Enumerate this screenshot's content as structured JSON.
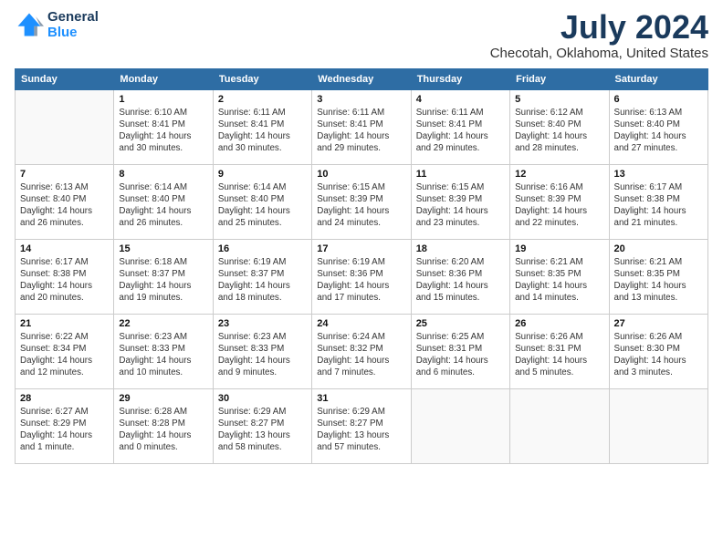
{
  "header": {
    "logo_line1": "General",
    "logo_line2": "Blue",
    "main_title": "July 2024",
    "sub_title": "Checotah, Oklahoma, United States"
  },
  "calendar": {
    "headers": [
      "Sunday",
      "Monday",
      "Tuesday",
      "Wednesday",
      "Thursday",
      "Friday",
      "Saturday"
    ],
    "rows": [
      [
        {
          "num": "",
          "info": ""
        },
        {
          "num": "1",
          "info": "Sunrise: 6:10 AM\nSunset: 8:41 PM\nDaylight: 14 hours\nand 30 minutes."
        },
        {
          "num": "2",
          "info": "Sunrise: 6:11 AM\nSunset: 8:41 PM\nDaylight: 14 hours\nand 30 minutes."
        },
        {
          "num": "3",
          "info": "Sunrise: 6:11 AM\nSunset: 8:41 PM\nDaylight: 14 hours\nand 29 minutes."
        },
        {
          "num": "4",
          "info": "Sunrise: 6:11 AM\nSunset: 8:41 PM\nDaylight: 14 hours\nand 29 minutes."
        },
        {
          "num": "5",
          "info": "Sunrise: 6:12 AM\nSunset: 8:40 PM\nDaylight: 14 hours\nand 28 minutes."
        },
        {
          "num": "6",
          "info": "Sunrise: 6:13 AM\nSunset: 8:40 PM\nDaylight: 14 hours\nand 27 minutes."
        }
      ],
      [
        {
          "num": "7",
          "info": "Sunrise: 6:13 AM\nSunset: 8:40 PM\nDaylight: 14 hours\nand 26 minutes."
        },
        {
          "num": "8",
          "info": "Sunrise: 6:14 AM\nSunset: 8:40 PM\nDaylight: 14 hours\nand 26 minutes."
        },
        {
          "num": "9",
          "info": "Sunrise: 6:14 AM\nSunset: 8:40 PM\nDaylight: 14 hours\nand 25 minutes."
        },
        {
          "num": "10",
          "info": "Sunrise: 6:15 AM\nSunset: 8:39 PM\nDaylight: 14 hours\nand 24 minutes."
        },
        {
          "num": "11",
          "info": "Sunrise: 6:15 AM\nSunset: 8:39 PM\nDaylight: 14 hours\nand 23 minutes."
        },
        {
          "num": "12",
          "info": "Sunrise: 6:16 AM\nSunset: 8:39 PM\nDaylight: 14 hours\nand 22 minutes."
        },
        {
          "num": "13",
          "info": "Sunrise: 6:17 AM\nSunset: 8:38 PM\nDaylight: 14 hours\nand 21 minutes."
        }
      ],
      [
        {
          "num": "14",
          "info": "Sunrise: 6:17 AM\nSunset: 8:38 PM\nDaylight: 14 hours\nand 20 minutes."
        },
        {
          "num": "15",
          "info": "Sunrise: 6:18 AM\nSunset: 8:37 PM\nDaylight: 14 hours\nand 19 minutes."
        },
        {
          "num": "16",
          "info": "Sunrise: 6:19 AM\nSunset: 8:37 PM\nDaylight: 14 hours\nand 18 minutes."
        },
        {
          "num": "17",
          "info": "Sunrise: 6:19 AM\nSunset: 8:36 PM\nDaylight: 14 hours\nand 17 minutes."
        },
        {
          "num": "18",
          "info": "Sunrise: 6:20 AM\nSunset: 8:36 PM\nDaylight: 14 hours\nand 15 minutes."
        },
        {
          "num": "19",
          "info": "Sunrise: 6:21 AM\nSunset: 8:35 PM\nDaylight: 14 hours\nand 14 minutes."
        },
        {
          "num": "20",
          "info": "Sunrise: 6:21 AM\nSunset: 8:35 PM\nDaylight: 14 hours\nand 13 minutes."
        }
      ],
      [
        {
          "num": "21",
          "info": "Sunrise: 6:22 AM\nSunset: 8:34 PM\nDaylight: 14 hours\nand 12 minutes."
        },
        {
          "num": "22",
          "info": "Sunrise: 6:23 AM\nSunset: 8:33 PM\nDaylight: 14 hours\nand 10 minutes."
        },
        {
          "num": "23",
          "info": "Sunrise: 6:23 AM\nSunset: 8:33 PM\nDaylight: 14 hours\nand 9 minutes."
        },
        {
          "num": "24",
          "info": "Sunrise: 6:24 AM\nSunset: 8:32 PM\nDaylight: 14 hours\nand 7 minutes."
        },
        {
          "num": "25",
          "info": "Sunrise: 6:25 AM\nSunset: 8:31 PM\nDaylight: 14 hours\nand 6 minutes."
        },
        {
          "num": "26",
          "info": "Sunrise: 6:26 AM\nSunset: 8:31 PM\nDaylight: 14 hours\nand 5 minutes."
        },
        {
          "num": "27",
          "info": "Sunrise: 6:26 AM\nSunset: 8:30 PM\nDaylight: 14 hours\nand 3 minutes."
        }
      ],
      [
        {
          "num": "28",
          "info": "Sunrise: 6:27 AM\nSunset: 8:29 PM\nDaylight: 14 hours\nand 1 minute."
        },
        {
          "num": "29",
          "info": "Sunrise: 6:28 AM\nSunset: 8:28 PM\nDaylight: 14 hours\nand 0 minutes."
        },
        {
          "num": "30",
          "info": "Sunrise: 6:29 AM\nSunset: 8:27 PM\nDaylight: 13 hours\nand 58 minutes."
        },
        {
          "num": "31",
          "info": "Sunrise: 6:29 AM\nSunset: 8:27 PM\nDaylight: 13 hours\nand 57 minutes."
        },
        {
          "num": "",
          "info": ""
        },
        {
          "num": "",
          "info": ""
        },
        {
          "num": "",
          "info": ""
        }
      ]
    ]
  }
}
